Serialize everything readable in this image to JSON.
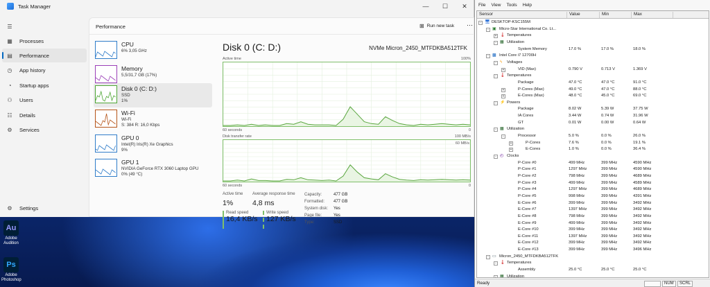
{
  "desktop": {
    "icons": [
      {
        "label": "Adobe Audition",
        "glyph": "Au",
        "color": "#001e36",
        "fg": "#9999ff"
      },
      {
        "label": "Adobe Photoshop",
        "glyph": "Ps",
        "color": "#001e36",
        "fg": "#31a8ff"
      }
    ]
  },
  "taskmgr": {
    "title": "Task Manager",
    "nav": [
      {
        "label": "Processes",
        "icon": "processes-icon"
      },
      {
        "label": "Performance",
        "icon": "performance-icon"
      },
      {
        "label": "App history",
        "icon": "app-history-icon"
      },
      {
        "label": "Startup apps",
        "icon": "startup-icon"
      },
      {
        "label": "Users",
        "icon": "users-icon"
      },
      {
        "label": "Details",
        "icon": "details-icon"
      },
      {
        "label": "Services",
        "icon": "services-icon"
      }
    ],
    "settings_label": "Settings",
    "header_title": "Performance",
    "run_new_task": "Run new task",
    "side": [
      {
        "name": "CPU",
        "sub": [
          "6% 3,05 GHz"
        ],
        "color": "#2f7cc9"
      },
      {
        "name": "Memory",
        "sub": [
          "5,5/31,7 GB (17%)"
        ],
        "color": "#9b3fb8"
      },
      {
        "name": "Disk 0 (C: D:)",
        "sub": [
          "SSD",
          "1%"
        ],
        "color": "#4da534"
      },
      {
        "name": "Wi-Fi",
        "sub": [
          "Wi-Fi",
          "S: 384 R: 16,0 Kbps"
        ],
        "color": "#b55418"
      },
      {
        "name": "GPU 0",
        "sub": [
          "Intel(R) Iris(R) Xe Graphics",
          "9%"
        ],
        "color": "#2f7cc9"
      },
      {
        "name": "GPU 1",
        "sub": [
          "NVIDIA GeForce RTX 3060 Laptop GPU",
          "0% (49 °C)"
        ],
        "color": "#2f7cc9"
      }
    ],
    "detail": {
      "title": "Disk 0 (C: D:)",
      "model": "NVMe Micron_2450_MTFDKBA512TFK",
      "graph1_label": "Active time",
      "graph1_max": "100%",
      "graph1_time": "60 seconds",
      "graph1_min": "0",
      "graph1_values": [
        0,
        0,
        1,
        0,
        2,
        0,
        1,
        0,
        0,
        3,
        2,
        6,
        2,
        1,
        1,
        1,
        0,
        10,
        30,
        18,
        6,
        3,
        2,
        14,
        8,
        3,
        1,
        0,
        2,
        1,
        2,
        3,
        2,
        1,
        2,
        1
      ],
      "graph2_label": "Disk transfer rate",
      "graph2_max": "100 MB/s",
      "graph2_mid": "60 MB/s",
      "graph2_time": "60 seconds",
      "graph2_min": "0",
      "graph2_values": [
        0,
        0,
        2,
        0,
        5,
        1,
        1,
        0,
        0,
        4,
        3,
        8,
        3,
        2,
        1,
        2,
        0,
        12,
        40,
        22,
        8,
        5,
        3,
        18,
        10,
        4,
        2,
        1,
        3,
        2,
        3,
        4,
        3,
        2,
        3,
        2
      ],
      "active_time_label": "Active time",
      "active_time": "1%",
      "resp_label": "Average response time",
      "resp": "4,8 ms",
      "read_label": "Read speed",
      "read": "16,4 KB/s",
      "write_label": "Write speed",
      "write": "127 KB/s",
      "props": [
        {
          "k": "Capacity:",
          "v": "477 GB"
        },
        {
          "k": "Formatted:",
          "v": "477 GB"
        },
        {
          "k": "System disk:",
          "v": "Yes"
        },
        {
          "k": "Page file:",
          "v": "Yes"
        },
        {
          "k": "Type:",
          "v": "SSD"
        }
      ]
    }
  },
  "hwinfo": {
    "menu": [
      "File",
      "View",
      "Tools",
      "Help"
    ],
    "columns": [
      "Sensor",
      "Value",
      "Min",
      "Max"
    ],
    "rows": [
      {
        "lvl": 0,
        "tw": "-",
        "icon": "computer-icon",
        "name": "DESKTOP-KSC155M",
        "v": "",
        "mn": "",
        "mx": ""
      },
      {
        "lvl": 1,
        "tw": "-",
        "icon": "board-icon",
        "name": "Micro-Star International Co. Lt...",
        "v": "",
        "mn": "",
        "mx": ""
      },
      {
        "lvl": 2,
        "tw": "+",
        "icon": "temperature-icon",
        "name": "Temperatures",
        "v": "",
        "mn": "",
        "mx": ""
      },
      {
        "lvl": 2,
        "tw": "-",
        "icon": "utilization-icon",
        "name": "Utilization",
        "v": "",
        "mn": "",
        "mx": ""
      },
      {
        "lvl": 3,
        "tw": "",
        "icon": "",
        "name": "System Memory",
        "v": "17.0 %",
        "mn": "17.0 %",
        "mx": "18.0 %"
      },
      {
        "lvl": 1,
        "tw": "-",
        "icon": "cpu-icon",
        "name": "Intel Core i7 12700H",
        "v": "",
        "mn": "",
        "mx": ""
      },
      {
        "lvl": 2,
        "tw": "-",
        "icon": "voltage-icon",
        "name": "Voltages",
        "v": "",
        "mn": "",
        "mx": ""
      },
      {
        "lvl": 3,
        "tw": "+",
        "icon": "",
        "name": "VID (Max)",
        "v": "0.790 V",
        "mn": "0.713 V",
        "mx": "1.369 V"
      },
      {
        "lvl": 2,
        "tw": "-",
        "icon": "temperature-icon",
        "name": "Temperatures",
        "v": "",
        "mn": "",
        "mx": ""
      },
      {
        "lvl": 3,
        "tw": "",
        "icon": "",
        "name": "Package",
        "v": "47.0 °C",
        "mn": "47.0 °C",
        "mx": "91.0 °C"
      },
      {
        "lvl": 3,
        "tw": "+",
        "icon": "",
        "name": "P-Cores (Max)",
        "v": "49.0 °C",
        "mn": "47.0 °C",
        "mx": "88.0 °C"
      },
      {
        "lvl": 3,
        "tw": "+",
        "icon": "",
        "name": "E-Cores (Max)",
        "v": "48.0 °C",
        "mn": "45.0 °C",
        "mx": "69.0 °C"
      },
      {
        "lvl": 2,
        "tw": "-",
        "icon": "power-icon",
        "name": "Powers",
        "v": "",
        "mn": "",
        "mx": ""
      },
      {
        "lvl": 3,
        "tw": "",
        "icon": "",
        "name": "Package",
        "v": "8.02 W",
        "mn": "5.39 W",
        "mx": "37.75 W"
      },
      {
        "lvl": 3,
        "tw": "",
        "icon": "",
        "name": "IA Cores",
        "v": "3.44 W",
        "mn": "0.74 W",
        "mx": "31.96 W"
      },
      {
        "lvl": 3,
        "tw": "",
        "icon": "",
        "name": "GT",
        "v": "0.01 W",
        "mn": "0.00 W",
        "mx": "0.64 W"
      },
      {
        "lvl": 2,
        "tw": "-",
        "icon": "utilization-icon",
        "name": "Utilization",
        "v": "",
        "mn": "",
        "mx": ""
      },
      {
        "lvl": 3,
        "tw": "-",
        "icon": "",
        "name": "Processor",
        "v": "5.0 %",
        "mn": "0.0 %",
        "mx": "26.0 %"
      },
      {
        "lvl": 4,
        "tw": "+",
        "icon": "",
        "name": "P-Cores",
        "v": "7.6 %",
        "mn": "0.0 %",
        "mx": "19.1 %"
      },
      {
        "lvl": 4,
        "tw": "+",
        "icon": "",
        "name": "E-Cores",
        "v": "1.0 %",
        "mn": "0.0 %",
        "mx": "36.4 %"
      },
      {
        "lvl": 2,
        "tw": "-",
        "icon": "clock-icon",
        "name": "Clocks",
        "v": "",
        "mn": "",
        "mx": ""
      },
      {
        "lvl": 3,
        "tw": "",
        "icon": "",
        "name": "P-Core #0",
        "v": "499 MHz",
        "mn": "399 MHz",
        "mx": "4590 MHz"
      },
      {
        "lvl": 3,
        "tw": "",
        "icon": "",
        "name": "P-Core #1",
        "v": "1297 MHz",
        "mn": "399 MHz",
        "mx": "4590 MHz"
      },
      {
        "lvl": 3,
        "tw": "",
        "icon": "",
        "name": "P-Core #2",
        "v": "798 MHz",
        "mn": "399 MHz",
        "mx": "4689 MHz"
      },
      {
        "lvl": 3,
        "tw": "",
        "icon": "",
        "name": "P-Core #3",
        "v": "499 MHz",
        "mn": "399 MHz",
        "mx": "4589 MHz"
      },
      {
        "lvl": 3,
        "tw": "",
        "icon": "",
        "name": "P-Core #4",
        "v": "1297 MHz",
        "mn": "399 MHz",
        "mx": "4689 MHz"
      },
      {
        "lvl": 3,
        "tw": "",
        "icon": "",
        "name": "P-Core #5",
        "v": "998 MHz",
        "mn": "399 MHz",
        "mx": "4391 MHz"
      },
      {
        "lvl": 3,
        "tw": "",
        "icon": "",
        "name": "E-Core #6",
        "v": "399 MHz",
        "mn": "399 MHz",
        "mx": "3492 MHz"
      },
      {
        "lvl": 3,
        "tw": "",
        "icon": "",
        "name": "E-Core #7",
        "v": "1397 MHz",
        "mn": "399 MHz",
        "mx": "3492 MHz"
      },
      {
        "lvl": 3,
        "tw": "",
        "icon": "",
        "name": "E-Core #8",
        "v": "798 MHz",
        "mn": "399 MHz",
        "mx": "3492 MHz"
      },
      {
        "lvl": 3,
        "tw": "",
        "icon": "",
        "name": "E-Core #9",
        "v": "499 MHz",
        "mn": "399 MHz",
        "mx": "3492 MHz"
      },
      {
        "lvl": 3,
        "tw": "",
        "icon": "",
        "name": "E-Core #10",
        "v": "399 MHz",
        "mn": "399 MHz",
        "mx": "3492 MHz"
      },
      {
        "lvl": 3,
        "tw": "",
        "icon": "",
        "name": "E-Core #11",
        "v": "1397 MHz",
        "mn": "399 MHz",
        "mx": "3492 MHz"
      },
      {
        "lvl": 3,
        "tw": "",
        "icon": "",
        "name": "E-Core #12",
        "v": "399 MHz",
        "mn": "399 MHz",
        "mx": "3492 MHz"
      },
      {
        "lvl": 3,
        "tw": "",
        "icon": "",
        "name": "E-Core #13",
        "v": "399 MHz",
        "mn": "399 MHz",
        "mx": "3496 MHz"
      },
      {
        "lvl": 1,
        "tw": "-",
        "icon": "disk-icon",
        "name": "Micron_2450_MTFDKBA512TFK",
        "v": "",
        "mn": "",
        "mx": ""
      },
      {
        "lvl": 2,
        "tw": "-",
        "icon": "temperature-icon",
        "name": "Temperatures",
        "v": "",
        "mn": "",
        "mx": ""
      },
      {
        "lvl": 3,
        "tw": "",
        "icon": "",
        "name": "Assembly",
        "v": "25.0 °C",
        "mn": "25.0 °C",
        "mx": "25.0 °C"
      },
      {
        "lvl": 2,
        "tw": "-",
        "icon": "utilization-icon",
        "name": "Utilization",
        "v": "",
        "mn": "",
        "mx": ""
      }
    ],
    "status_ready": "Ready",
    "status_num": "NUM",
    "status_scrl": "SCRL"
  }
}
